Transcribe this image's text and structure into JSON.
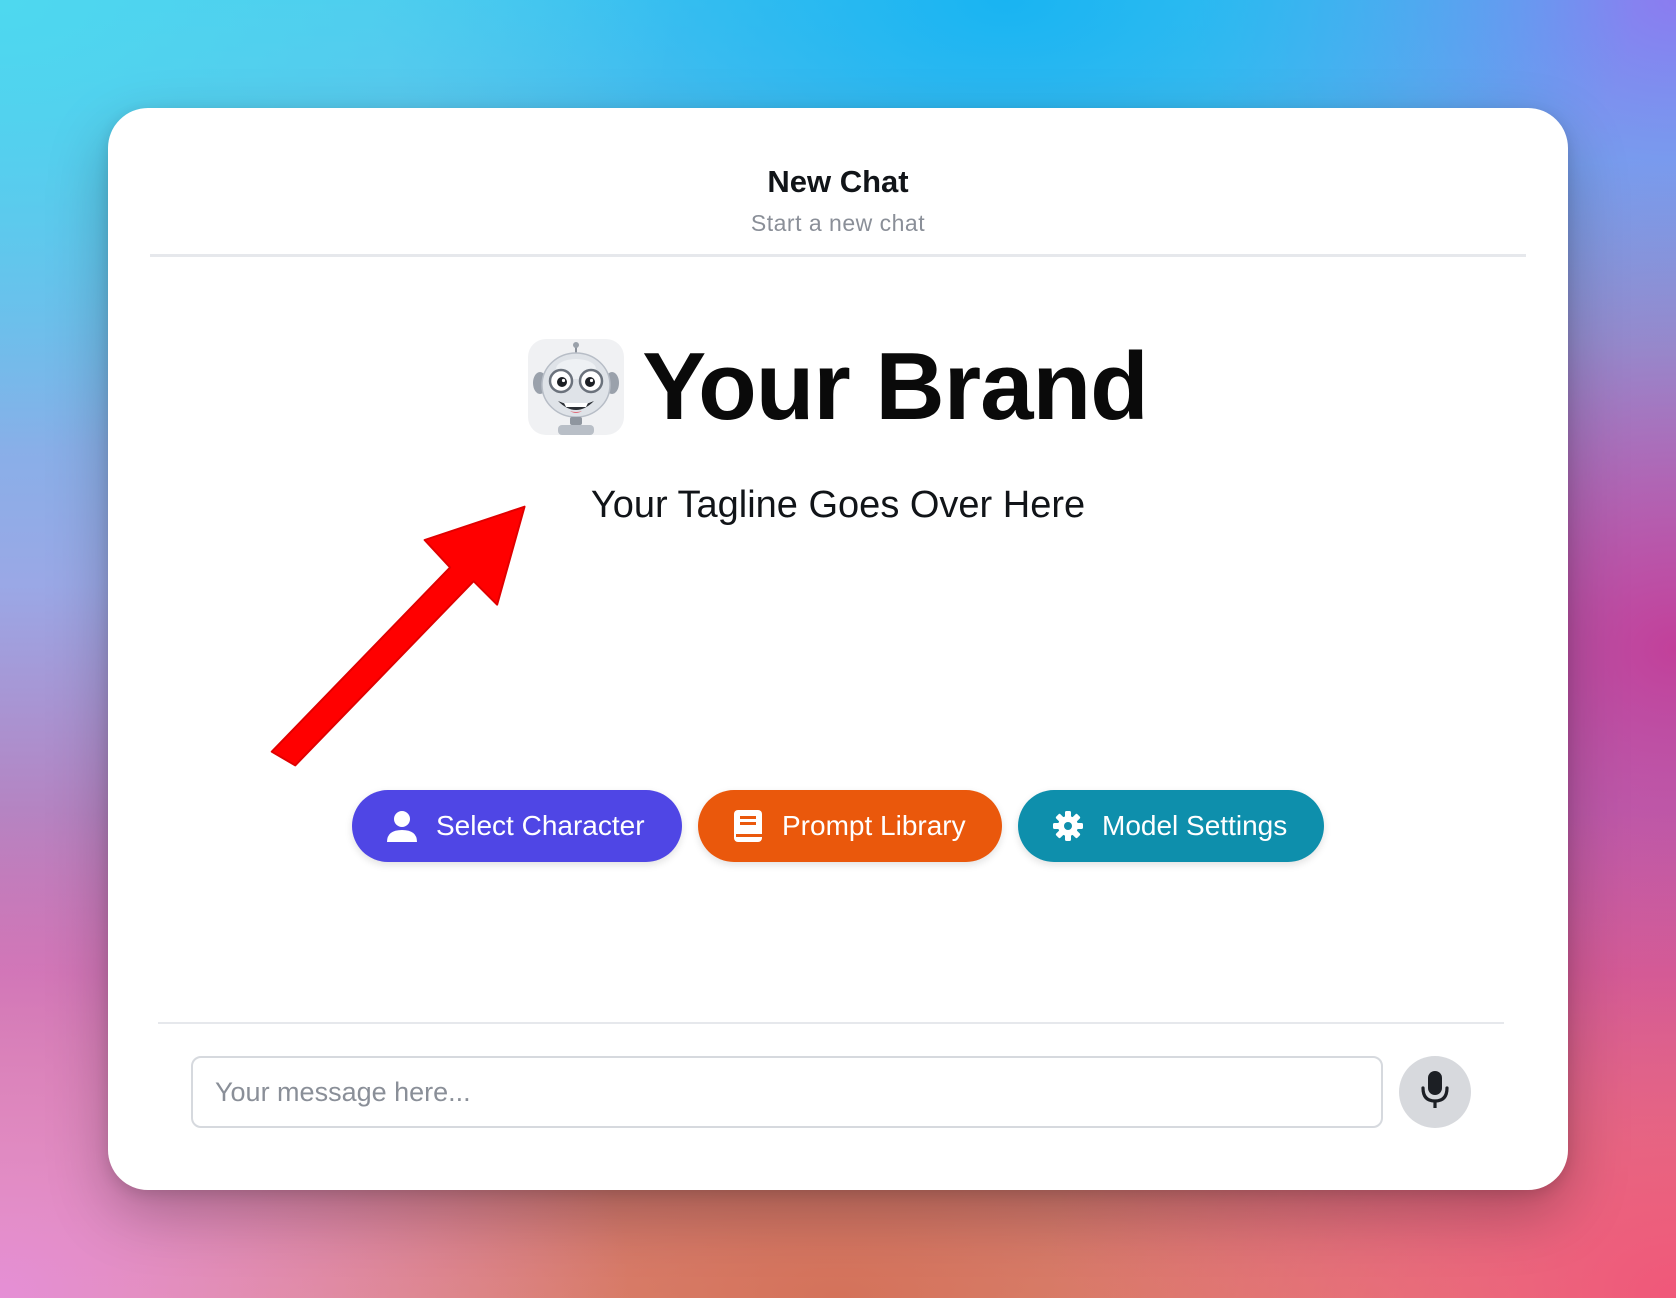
{
  "header": {
    "title": "New Chat",
    "subtitle": "Start a new chat"
  },
  "brand": {
    "logo_icon": "robot-mascot-icon",
    "name": "Your Brand",
    "tagline": "Your Tagline Goes Over Here"
  },
  "annotation": {
    "arrow_icon": "red-pointer-arrow",
    "color": "#ff0000"
  },
  "actions": [
    {
      "label": "Select Character",
      "icon": "user-icon",
      "color": "#4f46e5"
    },
    {
      "label": "Prompt Library",
      "icon": "book-icon",
      "color": "#ea580c"
    },
    {
      "label": "Model Settings",
      "icon": "gear-icon",
      "color": "#0e8fac"
    }
  ],
  "composer": {
    "placeholder": "Your message here...",
    "value": "",
    "mic_icon": "microphone-icon"
  }
}
